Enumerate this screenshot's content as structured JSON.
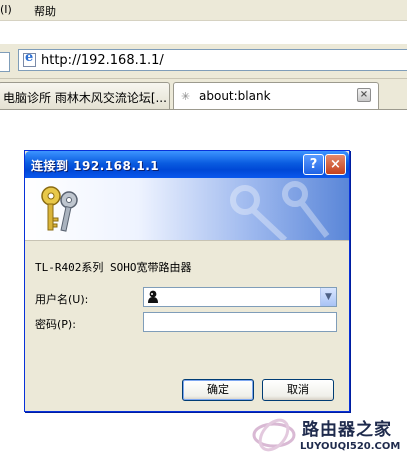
{
  "browser": {
    "menu": [
      "(I)",
      "帮助"
    ],
    "address": "http://192.168.1.1/",
    "tabs": [
      {
        "label": "电脑诊所 雨林木风交流论坛[..."
      },
      {
        "label": "about:blank"
      }
    ],
    "close_tab_glyph": "×"
  },
  "dialog": {
    "title": "连接到 192.168.1.1",
    "help_glyph": "?",
    "close_glyph": "×",
    "message": "TL-R402系列 SOHO宽带路由器",
    "username_label": "用户名(U):",
    "password_label": "密码(P):",
    "username_value": "",
    "password_value": "",
    "dropdown_glyph": "▼",
    "ok_label": "确定",
    "cancel_label": "取消"
  },
  "watermark": {
    "title": "路由器之家",
    "url": "LUYOUQI520.COM"
  },
  "colors": {
    "titlebar": "#0a5ce0",
    "chrome": "#ece9d8",
    "dialog_border": "#0831d9"
  }
}
